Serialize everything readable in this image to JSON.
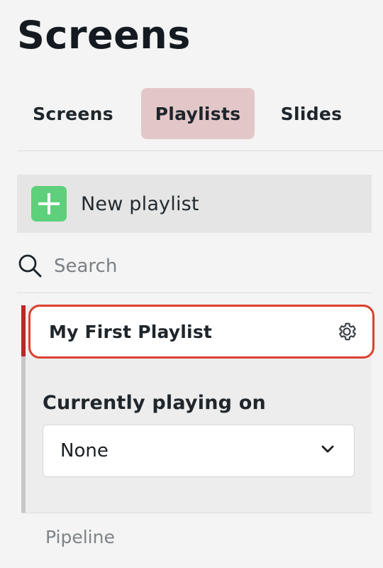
{
  "page": {
    "title": "Screens"
  },
  "tabs": [
    {
      "label": "Screens",
      "active": false
    },
    {
      "label": "Playlists",
      "active": true
    },
    {
      "label": "Slides",
      "active": false
    }
  ],
  "new_playlist": {
    "label": "New playlist",
    "icon": "plus-icon"
  },
  "search": {
    "placeholder": "Search",
    "icon": "search-icon"
  },
  "playlist": {
    "name": "My First Playlist",
    "settings_icon": "gear-icon",
    "currently_playing_label": "Currently playing on",
    "currently_playing_value": "None",
    "dropdown_icon": "chevron-down-icon"
  },
  "footer": {
    "label": "Pipeline"
  },
  "colors": {
    "background": "#f3f4f3",
    "active_tab": "#e3c7c8",
    "new_playlist_bg": "#e4e5e4",
    "plus_button": "#5ed07b",
    "selected_border": "#dc402f",
    "selected_bar": "#b42a24"
  }
}
